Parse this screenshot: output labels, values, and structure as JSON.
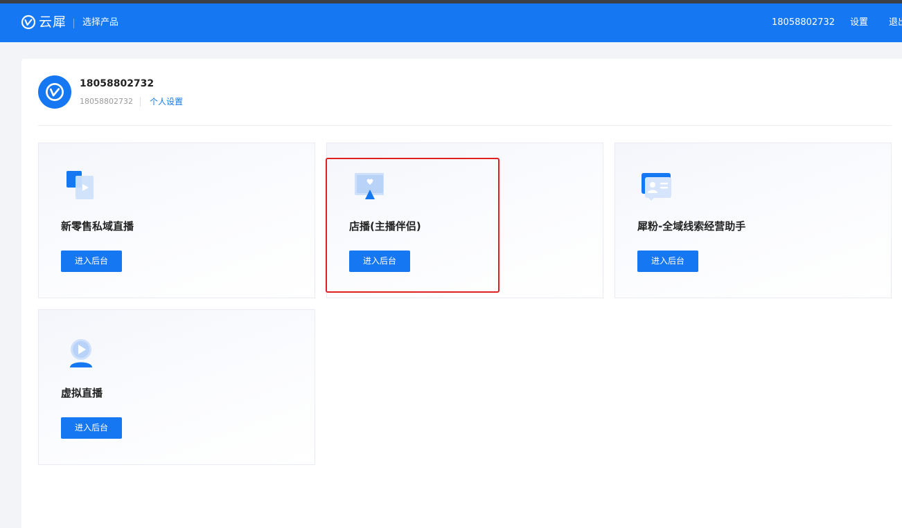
{
  "header": {
    "logo_text": "云犀",
    "subtitle": "选择产品",
    "phone": "18058802732",
    "settings_label": "设置",
    "logout_label": "退出"
  },
  "user": {
    "name": "18058802732",
    "account": "18058802732",
    "settings_link": "个人设置"
  },
  "products": [
    {
      "title": "新零售私域直播",
      "button": "进入后台",
      "icon": "screens-play-icon"
    },
    {
      "title": "店播(主播伴侣)",
      "button": "进入后台",
      "icon": "monitor-heart-icon"
    },
    {
      "title": "犀粉-全域线索经营助手",
      "button": "进入后台",
      "icon": "contact-card-icon"
    },
    {
      "title": "虚拟直播",
      "button": "进入后台",
      "icon": "virtual-avatar-play-icon"
    }
  ],
  "annotation": {
    "highlight_color": "#e02020",
    "highlighted_product_index": 1
  },
  "colors": {
    "brand": "#1677f2",
    "header_bg": "#1677f2",
    "page_bg": "#f2f4f8"
  }
}
